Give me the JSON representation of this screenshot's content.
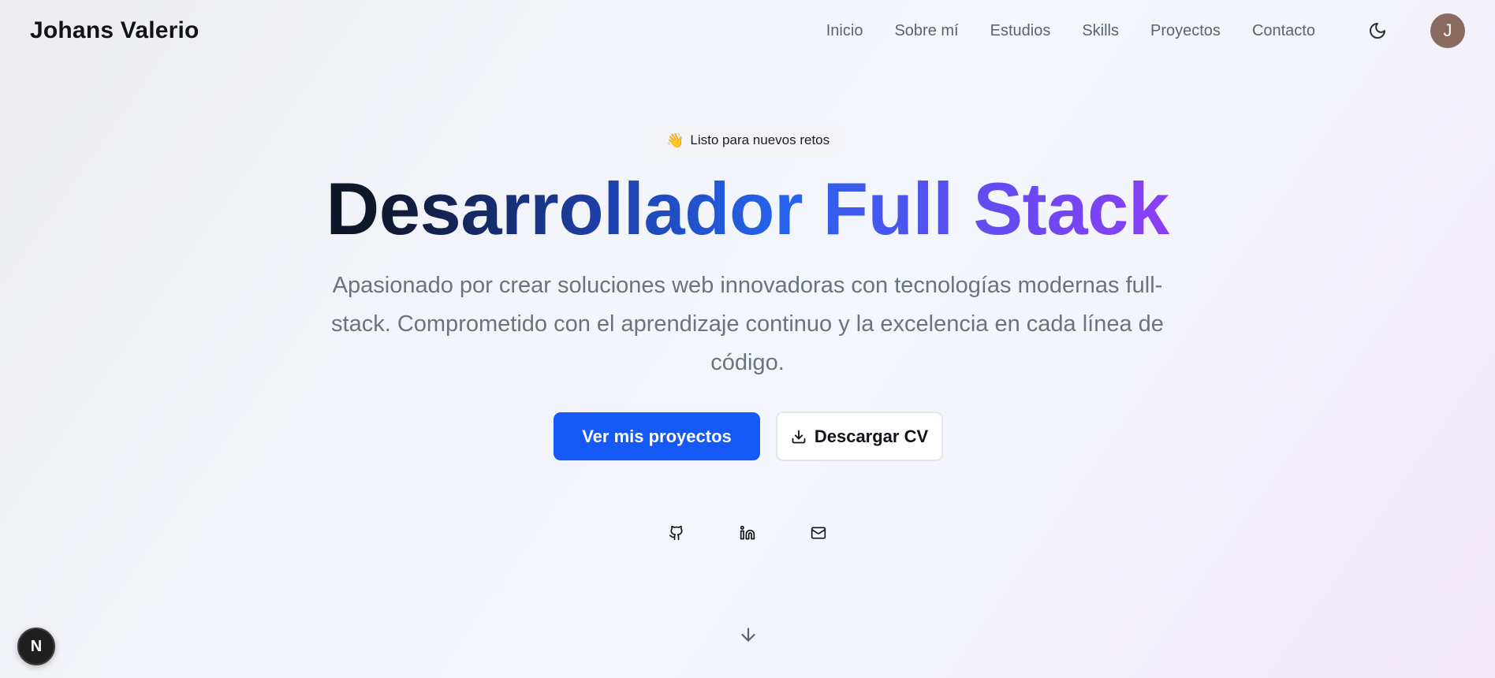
{
  "header": {
    "brand": "Johans Valerio",
    "nav": [
      "Inicio",
      "Sobre mí",
      "Estudios",
      "Skills",
      "Proyectos",
      "Contacto"
    ],
    "theme_icon": "moon-icon",
    "avatar_initial": "J",
    "avatar_color": "#8a6b5f"
  },
  "hero": {
    "badge_emoji": "👋",
    "badge_text": "Listo para nuevos retos",
    "title": "Desarrollador Full Stack",
    "subtitle": "Apasionado por crear soluciones web innovadoras con tecnologías modernas full-stack. Comprometido con el aprendizaje continuo y la excelencia en cada línea de código.",
    "primary_button": "Ver mis proyectos",
    "secondary_button": "Descargar CV",
    "socials": [
      "github-icon",
      "linkedin-icon",
      "mail-icon"
    ],
    "scroll_icon": "arrow-down-icon"
  },
  "dev_badge": {
    "label": "N"
  },
  "colors": {
    "primary": "#1559f6",
    "title_gradient": [
      "#0f172a",
      "#2563eb",
      "#9333ea"
    ],
    "muted_text": "#6b7280"
  }
}
